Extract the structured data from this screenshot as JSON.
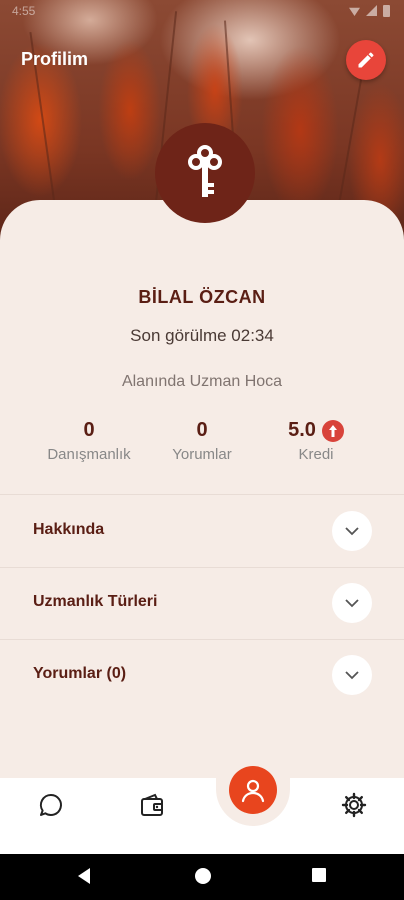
{
  "status_bar": {
    "time": "4:55"
  },
  "header": {
    "title": "Profilim",
    "edit_icon": "pencil-icon"
  },
  "profile": {
    "avatar_icon": "key-icon",
    "name": "BİLAL ÖZCAN",
    "last_seen": "Son görülme 02:34",
    "title": "Alanında Uzman Hoca"
  },
  "stats": [
    {
      "value": "0",
      "label": "Danışmanlık"
    },
    {
      "value": "0",
      "label": "Yorumlar"
    },
    {
      "value": "5.0",
      "label": "Kredi",
      "badge_icon": "plus-icon"
    }
  ],
  "sections": [
    {
      "label": "Hakkında",
      "icon": "chevron-down-icon"
    },
    {
      "label": "Uzmanlık Türleri",
      "icon": "chevron-down-icon"
    },
    {
      "label": "Yorumlar (0)",
      "icon": "chevron-down-icon"
    }
  ],
  "bottom_nav": {
    "items": [
      "chat-icon",
      "wallet-icon",
      "profile-icon",
      "settings-icon"
    ],
    "active": "profile-icon"
  },
  "colors": {
    "accent": "#e8453a",
    "primary_dark": "#6e2418",
    "text_dark": "#5a1e14",
    "background": "#f6ece6"
  }
}
